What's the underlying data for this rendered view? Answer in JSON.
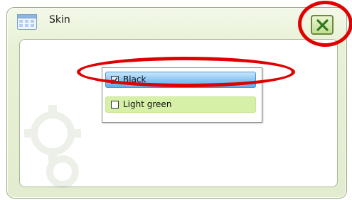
{
  "window": {
    "title": "Skin",
    "app_icon": "skin-window-icon",
    "close_icon": "close-x-icon"
  },
  "skin_list": {
    "items": [
      {
        "label": "Black",
        "checked": true,
        "selected": true
      },
      {
        "label": "Light green",
        "checked": false,
        "selected": false
      }
    ]
  },
  "colors": {
    "theme_green": "#d6f0a8",
    "selection_blue": "#88c4f2",
    "annotation_red": "#e00000"
  }
}
